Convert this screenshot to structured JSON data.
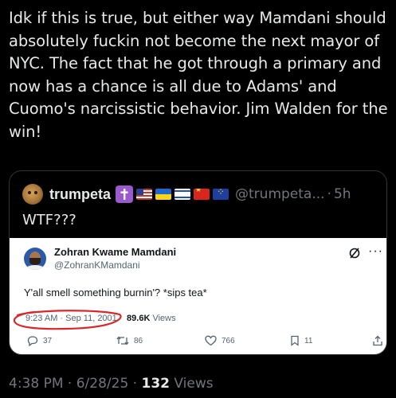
{
  "post": {
    "lines": [
      "Idk if this is true, but either way Mamdani should",
      "absolutely fuckin not become the next mayor of",
      "NYC. The fact that he got through a primary and",
      "now has a chance is all due to Adams' and",
      "Cuomo's narcissistic behavior. Jim Walden for the",
      "win!"
    ],
    "time": "4:38 PM",
    "date": "6/28/25",
    "views_count": "132",
    "views_label": "Views",
    "separator": "·"
  },
  "quote": {
    "name": "trumpeta",
    "handle": "@trumpeta...",
    "separator": "·",
    "time": "5h",
    "text": "WTF???",
    "badges": [
      "cross-icon",
      "us-flag-icon",
      "ukraine-flag-icon",
      "israel-flag-icon",
      "china-flag-icon",
      "eu-flag-icon"
    ]
  },
  "embedded_tweet": {
    "name": "Zohran Kwame Mamdani",
    "handle": "@ZohranKMamdani",
    "text": "Y'all smell something burnin'? *sips tea*",
    "time": "9:23 AM",
    "date": "Sep 11, 2001",
    "views_count": "89.6K",
    "views_label": "Views",
    "annotation_color": "#d62828",
    "actions": {
      "replies": "37",
      "reposts": "86",
      "likes": "766",
      "bookmarks": "11"
    }
  },
  "colors": {
    "background": "#000000",
    "text_primary": "#e7e9ea",
    "text_secondary": "#71767b",
    "border": "#2f3336"
  }
}
